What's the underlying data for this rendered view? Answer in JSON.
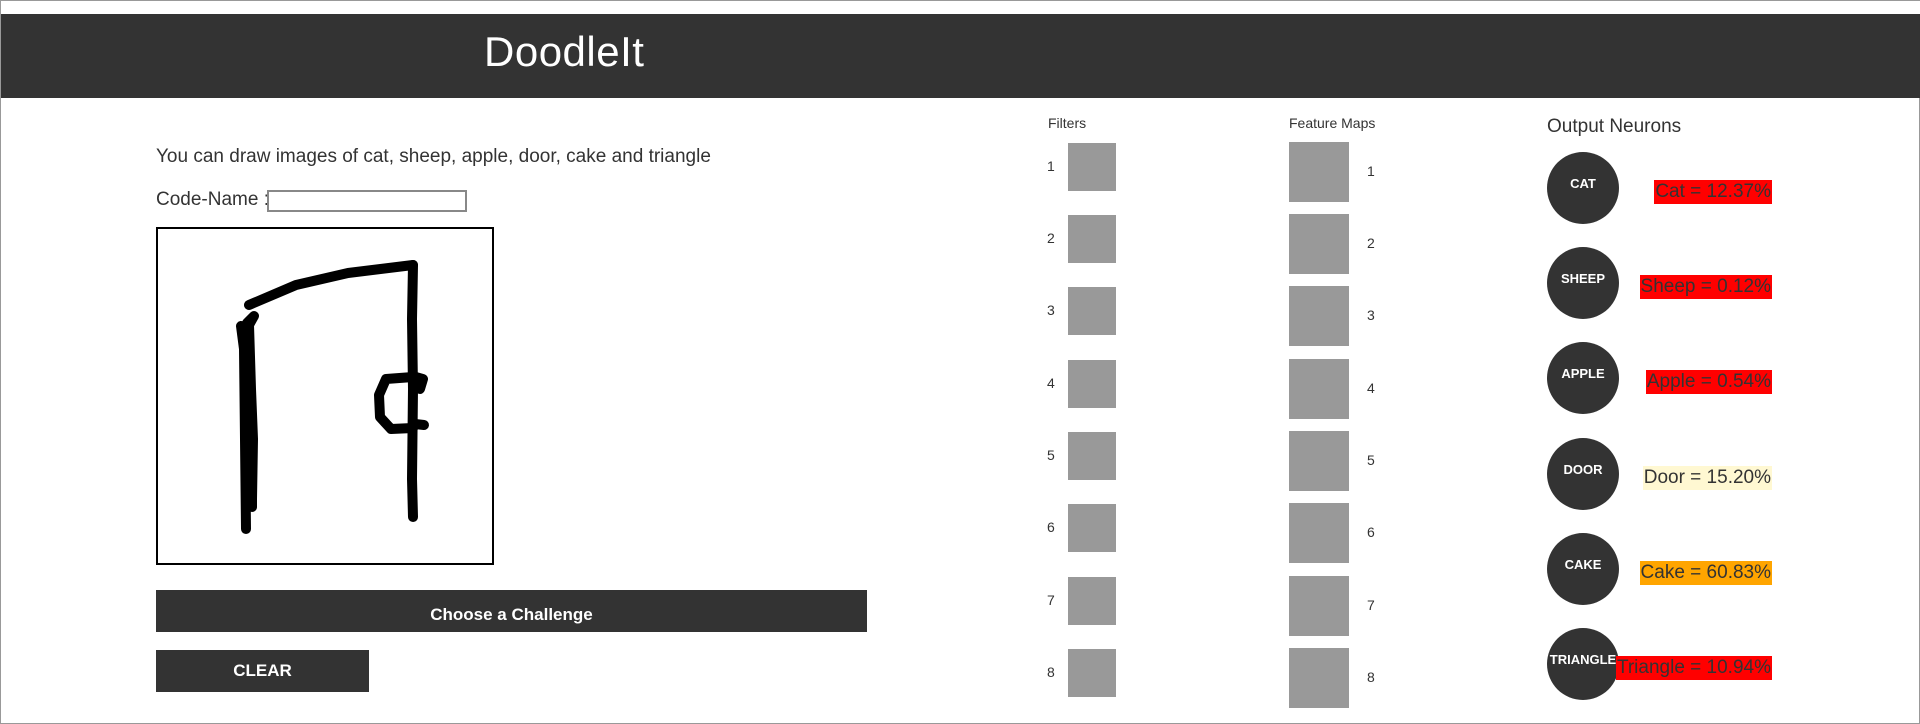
{
  "app": {
    "title": "DoodleIt"
  },
  "instructions": "You can draw images of cat, sheep, apple, door, cake and triangle",
  "code_name": {
    "label": "Code-Name :",
    "value": ""
  },
  "buttons": {
    "challenge": "Choose a Challenge",
    "clear": "CLEAR"
  },
  "filters": {
    "label": "Filters",
    "items": [
      "1",
      "2",
      "3",
      "4",
      "5",
      "6",
      "7",
      "8"
    ]
  },
  "feature_maps": {
    "label": "Feature Maps",
    "items": [
      "1",
      "2",
      "3",
      "4",
      "5",
      "6",
      "7",
      "8"
    ]
  },
  "output": {
    "title": "Output Neurons",
    "neurons": [
      {
        "name": "CAT",
        "prob_text": "Cat = 12.37%",
        "color": "#ff0000"
      },
      {
        "name": "SHEEP",
        "prob_text": "Sheep = 0.12%",
        "color": "#ff0000"
      },
      {
        "name": "APPLE",
        "prob_text": "Apple = 0.54%",
        "color": "#ff0000"
      },
      {
        "name": "DOOR",
        "prob_text": "Door = 15.20%",
        "color": "#fff8d2"
      },
      {
        "name": "CAKE",
        "prob_text": "Cake = 60.83%",
        "color": "#ffa500"
      },
      {
        "name": "TRIANGLE",
        "prob_text": "Triangle = 10.94%",
        "color": "#ff0000"
      }
    ]
  }
}
